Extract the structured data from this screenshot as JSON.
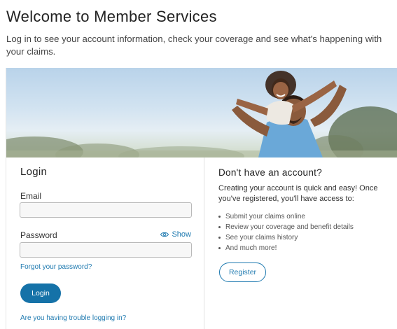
{
  "header": {
    "title": "Welcome to Member Services",
    "intro": "Log in to see your account information, check your coverage and see what's happening with your claims."
  },
  "login": {
    "title": "Login",
    "email_label": "Email",
    "email_value": "",
    "password_label": "Password",
    "password_value": "",
    "show_label": "Show",
    "forgot_link": "Forgot your password?",
    "login_button": "Login",
    "trouble_link": "Are you having trouble logging in?"
  },
  "register": {
    "title": "Don't have an account?",
    "description": "Creating your account is quick and easy! Once you've registered, you'll have access to:",
    "benefits": [
      "Submit your claims online",
      "Review your coverage and benefit details",
      "See your claims history",
      "And much more!"
    ],
    "register_button": "Register"
  },
  "colors": {
    "accent": "#1572a8",
    "link": "#1f7ab0"
  },
  "icons": {
    "show": "eye-icon"
  }
}
